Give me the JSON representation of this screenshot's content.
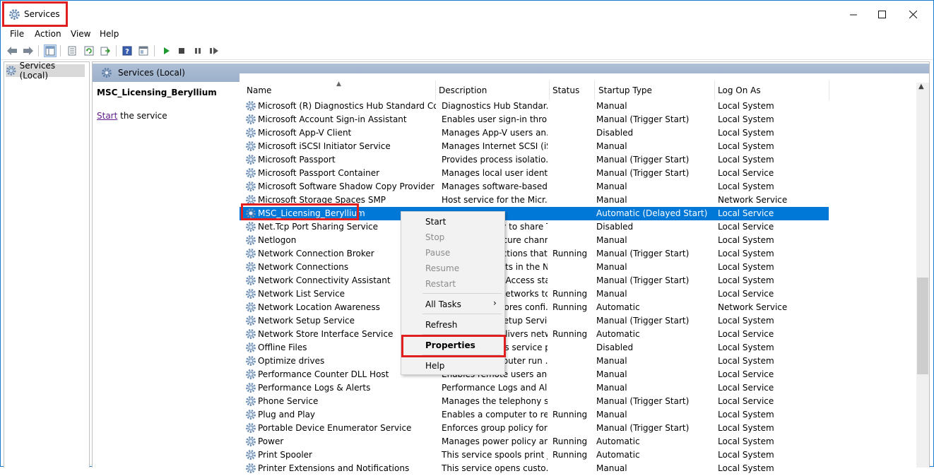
{
  "window": {
    "title": "Services",
    "icon": "gear-icon"
  },
  "menubar": {
    "file": "File",
    "action": "Action",
    "view": "View",
    "help": "Help"
  },
  "toolbar": {
    "icons": [
      "back-arrow-icon",
      "forward-arrow-icon",
      "show-hide-tree-icon",
      "export-list-icon",
      "refresh-icon",
      "export-icon",
      "help-icon",
      "properties-icon",
      "play-icon",
      "stop-icon",
      "pause-icon",
      "restart-icon"
    ]
  },
  "tree": {
    "root": "Services (Local)"
  },
  "pane": {
    "header": "Services (Local)",
    "selected_service": "MSC_Licensing_Beryllium",
    "start_link": "Start",
    "start_suffix": " the service"
  },
  "columns": {
    "name": "Name",
    "description": "Description",
    "status": "Status",
    "startup": "Startup Type",
    "logon": "Log On As"
  },
  "services": [
    {
      "name": "Microsoft (R) Diagnostics Hub Standard Collec...",
      "desc": "Diagnostics Hub Standar...",
      "status": "",
      "startup": "Manual",
      "logon": "Local System"
    },
    {
      "name": "Microsoft Account Sign-in Assistant",
      "desc": "Enables user sign-in thro...",
      "status": "",
      "startup": "Manual (Trigger Start)",
      "logon": "Local System"
    },
    {
      "name": "Microsoft App-V Client",
      "desc": "Manages App-V users an...",
      "status": "",
      "startup": "Disabled",
      "logon": "Local System"
    },
    {
      "name": "Microsoft iSCSI Initiator Service",
      "desc": "Manages Internet SCSI (iS...",
      "status": "",
      "startup": "Manual",
      "logon": "Local System"
    },
    {
      "name": "Microsoft Passport",
      "desc": "Provides process isolatio...",
      "status": "",
      "startup": "Manual (Trigger Start)",
      "logon": "Local System"
    },
    {
      "name": "Microsoft Passport Container",
      "desc": "Manages local user identi...",
      "status": "",
      "startup": "Manual (Trigger Start)",
      "logon": "Local Service"
    },
    {
      "name": "Microsoft Software Shadow Copy Provider",
      "desc": "Manages software-based ...",
      "status": "",
      "startup": "Manual",
      "logon": "Local System"
    },
    {
      "name": "Microsoft Storage Spaces SMP",
      "desc": "Host service for the Micr...",
      "status": "",
      "startup": "Manual",
      "logon": "Network Service"
    },
    {
      "name": "MSC_Licensing_Beryllium",
      "desc": "",
      "status": "",
      "startup": "Automatic (Delayed Start)",
      "logon": "Local Service"
    },
    {
      "name": "Net.Tcp Port Sharing Service",
      "desc": "Provides ability to share T...",
      "status": "",
      "startup": "Disabled",
      "logon": "Local Service"
    },
    {
      "name": "Netlogon",
      "desc": "Maintains a secure chann...",
      "status": "",
      "startup": "Manual",
      "logon": "Local System"
    },
    {
      "name": "Network Connection Broker",
      "desc": "Brokers connections that ...",
      "status": "Running",
      "startup": "Manual (Trigger Start)",
      "logon": "Local System"
    },
    {
      "name": "Network Connections",
      "desc": "Manages objects in the N...",
      "status": "",
      "startup": "Manual",
      "logon": "Local System"
    },
    {
      "name": "Network Connectivity Assistant",
      "desc": "Provides DirectAccess sta...",
      "status": "",
      "startup": "Manual (Trigger Start)",
      "logon": "Local System"
    },
    {
      "name": "Network List Service",
      "desc": "Identifies the networks to...",
      "status": "Running",
      "startup": "Manual",
      "logon": "Local Service"
    },
    {
      "name": "Network Location Awareness",
      "desc": "Collects and stores confi...",
      "status": "Running",
      "startup": "Automatic",
      "logon": "Network Service"
    },
    {
      "name": "Network Setup Service",
      "desc": "The Network Setup Servic...",
      "status": "",
      "startup": "Manual (Trigger Start)",
      "logon": "Local System"
    },
    {
      "name": "Network Store Interface Service",
      "desc": "This service delivers netw...",
      "status": "Running",
      "startup": "Automatic",
      "logon": "Local Service"
    },
    {
      "name": "Offline Files",
      "desc": "The Offline Files service p...",
      "status": "",
      "startup": "Disabled",
      "logon": "Local System"
    },
    {
      "name": "Optimize drives",
      "desc": "Helps the computer run ...",
      "status": "",
      "startup": "Manual",
      "logon": "Local System"
    },
    {
      "name": "Performance Counter DLL Host",
      "desc": "Enables remote users and...",
      "status": "",
      "startup": "Manual",
      "logon": "Local Service"
    },
    {
      "name": "Performance Logs & Alerts",
      "desc": "Performance Logs and Al...",
      "status": "",
      "startup": "Manual",
      "logon": "Local Service"
    },
    {
      "name": "Phone Service",
      "desc": "Manages the telephony s...",
      "status": "",
      "startup": "Manual (Trigger Start)",
      "logon": "Local Service"
    },
    {
      "name": "Plug and Play",
      "desc": "Enables a computer to re...",
      "status": "Running",
      "startup": "Manual",
      "logon": "Local System"
    },
    {
      "name": "Portable Device Enumerator Service",
      "desc": "Enforces group policy for...",
      "status": "",
      "startup": "Manual (Trigger Start)",
      "logon": "Local System"
    },
    {
      "name": "Power",
      "desc": "Manages power policy an...",
      "status": "Running",
      "startup": "Automatic",
      "logon": "Local System"
    },
    {
      "name": "Print Spooler",
      "desc": "This service spools print j...",
      "status": "Running",
      "startup": "Automatic",
      "logon": "Local System"
    },
    {
      "name": "Printer Extensions and Notifications",
      "desc": "This service opens custo...",
      "status": "",
      "startup": "Manual",
      "logon": "Local System"
    }
  ],
  "context_menu": {
    "start": "Start",
    "stop": "Stop",
    "pause": "Pause",
    "resume": "Resume",
    "restart": "Restart",
    "all_tasks": "All Tasks",
    "refresh": "Refresh",
    "properties": "Properties",
    "help": "Help"
  },
  "colors": {
    "selection": "#0078d7",
    "highlight_box": "#e02020",
    "pane_header": "#aebfd6"
  }
}
